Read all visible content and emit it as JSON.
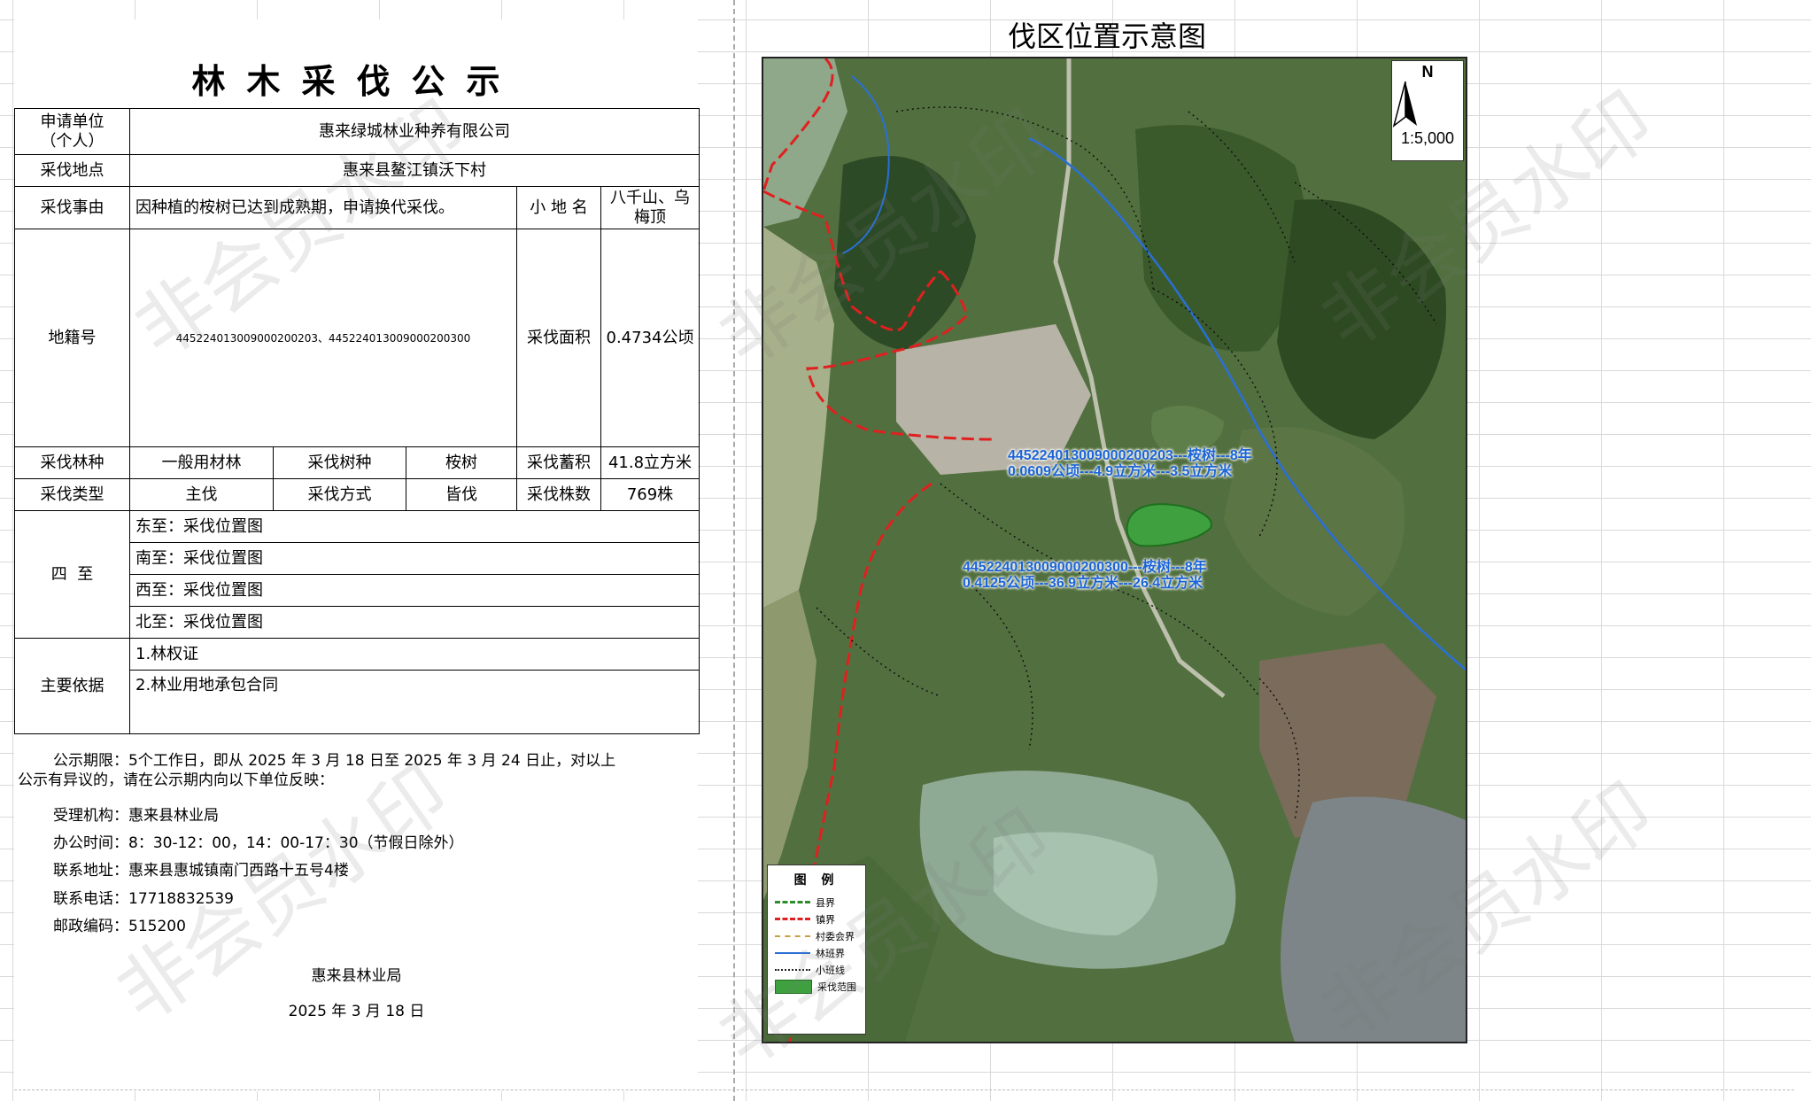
{
  "notice": {
    "title": "林木采伐公示",
    "rows": {
      "applicant_label": "申请单位\n（个人）",
      "applicant_value": "惠来绿城林业种养有限公司",
      "location_label": "采伐地点",
      "location_value": "惠来县鳌江镇沃下村",
      "reason_label": "采伐事由",
      "reason_value": "因种植的桉树已达到成熟期，申请换代采伐。",
      "small_place_label": "小 地 名",
      "small_place_value": "八千山、乌梅顶",
      "parcel_label": "地籍号",
      "parcel_value": "445224013009000200203、445224013009000200300",
      "area_label": "采伐面积",
      "area_value": "0.4734公顷",
      "forest_type_label": "采伐林种",
      "forest_type_value": "一般用材林",
      "tree_species_label": "采伐树种",
      "tree_species_value": "桉树",
      "volume_label": "采伐蓄积",
      "volume_value": "41.8立方米",
      "cut_type_label": "采伐类型",
      "cut_type_value": "主伐",
      "cut_method_label": "采伐方式",
      "cut_method_value": "皆伐",
      "count_label": "采伐株数",
      "count_value": "769株",
      "boundary_label": "四  至",
      "east": "东至：采伐位置图",
      "south": "南至：采伐位置图",
      "west": "西至：采伐位置图",
      "north": "北至：采伐位置图",
      "basis_label": "主要依据",
      "basis_1": "1.林权证",
      "basis_2": "2.林业用地承包合同"
    },
    "footer": {
      "period_line1": "公示期限：5个工作日，即从 2025 年 3 月 18 日至 2025 年 3 月 24 日止，对以上",
      "period_line2": "公示有异议的，请在公示期内向以下单位反映：",
      "agency": "受理机构：惠来县林业局",
      "hours": "办公时间：8：30-12：00，14：00-17：30（节假日除外）",
      "address": "联系地址：惠来县惠城镇南门西路十五号4楼",
      "phone": "联系电话：17718832539",
      "postcode": "邮政编码：515200",
      "issuer": "惠来县林业局",
      "date": "2025 年 3 月 18 日"
    }
  },
  "map": {
    "title": "伐区位置示意图",
    "north": "N",
    "scale": "1:5,000",
    "label1_line1": "445224013009000200203---桉树---8年",
    "label1_line2": "0.0609公顷---4.9立方米---3.5立方米",
    "label2_line1": "445224013009000200300---桉树---8年",
    "label2_line2": "0.4125公顷---36.9立方米---26.4立方米",
    "legend": {
      "title": "图 例",
      "items": [
        {
          "label": "县界",
          "color": "#2e8b2e"
        },
        {
          "label": "镇界",
          "color": "#e02020"
        },
        {
          "label": "村委会界",
          "color": "#c8a040"
        },
        {
          "label": "林班界",
          "color": "#2a6fd6"
        },
        {
          "label": "小班线",
          "color": "#222222"
        },
        {
          "label": "采伐范围",
          "color": "#3fa03f"
        }
      ]
    },
    "watermark": "非会员水印"
  }
}
